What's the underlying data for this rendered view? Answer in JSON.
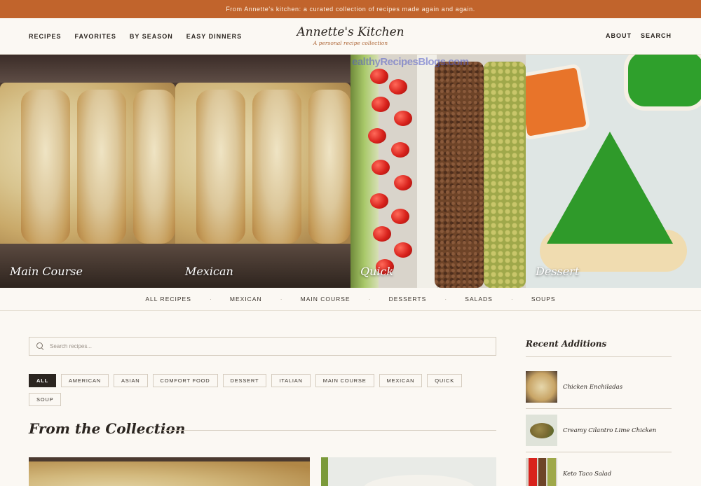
{
  "announcement": "From Annette's kitchen: a curated collection of recipes made again and again.",
  "nav": {
    "left": [
      "RECIPES",
      "FAVORITES",
      "BY SEASON",
      "EASY DINNERS"
    ],
    "right": [
      "ABOUT",
      "SEARCH"
    ]
  },
  "brand": {
    "title": "Annette's Kitchen",
    "tagline": "A personal recipe collection"
  },
  "hero": [
    {
      "label": "Main Course",
      "image": "chicken-enchiladas"
    },
    {
      "label": "Mexican",
      "image": "chicken-enchiladas"
    },
    {
      "label": "Quick",
      "image": "taco-salad"
    },
    {
      "label": "Dessert",
      "image": "sugar-cookies"
    }
  ],
  "hero_watermark": "ealthyRecipesBlogs.com",
  "categories": [
    "ALL RECIPES",
    "MEXICAN",
    "MAIN COURSE",
    "DESSERTS",
    "SALADS",
    "SOUPS"
  ],
  "category_separator": "·",
  "search": {
    "placeholder": "Search recipes..."
  },
  "tags": [
    "ALL",
    "AMERICAN",
    "ASIAN",
    "COMFORT FOOD",
    "DESSERT",
    "ITALIAN",
    "MAIN COURSE",
    "MEXICAN",
    "QUICK",
    "SOUP"
  ],
  "active_tag": "ALL",
  "collection": {
    "title": "From the Collection"
  },
  "sidebar": {
    "title": "Recent Additions",
    "items": [
      {
        "name": "Chicken Enchiladas"
      },
      {
        "name": "Creamy Cilantro Lime Chicken"
      },
      {
        "name": "Keto Taco Salad"
      }
    ]
  },
  "colors": {
    "accent": "#c1642c",
    "background": "#fbf8f3",
    "text": "#2b2520"
  }
}
